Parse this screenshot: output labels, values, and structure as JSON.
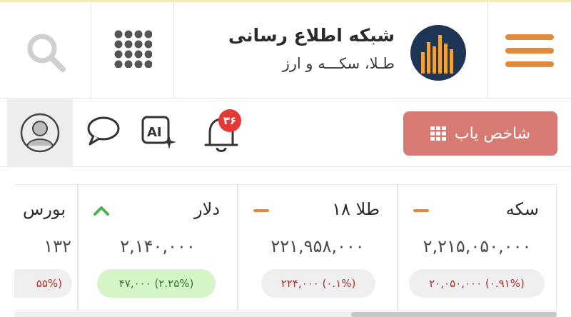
{
  "brand": {
    "title": "شبکه اطلاع رسانی",
    "subtitle": "طـلا، سکـــه و ارز"
  },
  "icons": {
    "search": "search-icon",
    "apps": "grid-icon",
    "menu": "hamburger-menu-icon",
    "logo": "bar-chart-logo",
    "profile": "user-avatar-icon",
    "chat": "chat-bubble-icon",
    "ai": "ai-sparkle-icon",
    "notifications": "bell-icon"
  },
  "toolbar": {
    "notifications_count": "۳۶",
    "finder_label": "شاخص یاب"
  },
  "colors": {
    "accent_orange": "#e08a3c",
    "finder_button": "#d77a73",
    "badge_red": "#e53935",
    "negative_text": "#b03030",
    "positive_text": "#2f7a2f",
    "positive_bg": "#d6f5c6",
    "logo_bg": "#1f3556"
  },
  "tickers": [
    {
      "name": "سکه",
      "trend": "neutral",
      "price": "۲,۲۱۵,۰۵۰,۰۰۰",
      "change": "۲۰,۰۵۰,۰۰۰ (۰.۹۱%)"
    },
    {
      "name": "طلا ۱۸",
      "trend": "neutral",
      "price": "۲۲۱,۹۵۸,۰۰۰",
      "change": "۲۲۴,۰۰۰ (۰.۱%)"
    },
    {
      "name": "دلار",
      "trend": "up",
      "price": "۲,۱۴۰,۰۰۰",
      "change": "۴۷,۰۰۰ (۲.۲۵%)"
    },
    {
      "name": "بورس",
      "trend": "neutral",
      "price": "۱۳۲",
      "change": "۵۵%)"
    }
  ]
}
